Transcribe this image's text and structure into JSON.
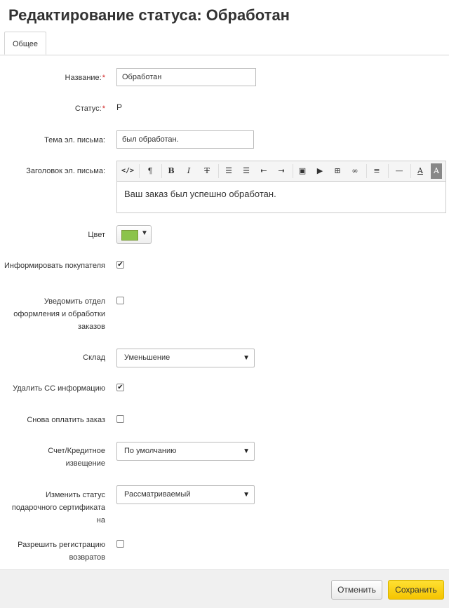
{
  "page": {
    "title": "Редактирование статуса: Обработан"
  },
  "tabs": [
    {
      "label": "Общее"
    }
  ],
  "fields": {
    "name": {
      "label": "Название:",
      "required": "*",
      "value": "Обработан"
    },
    "status": {
      "label": "Статус:",
      "required": "*",
      "value": "P"
    },
    "email_subject": {
      "label": "Тема эл. письма:",
      "value": "был обработан."
    },
    "email_header": {
      "label": "Заголовок эл. письма:",
      "value": "Ваш заказ был успешно обработан.",
      "toolbar_icons": [
        "code-view-icon",
        "paragraph-icon",
        "bold-icon",
        "italic-icon",
        "strikethrough-icon",
        "unordered-list-icon",
        "ordered-list-icon",
        "outdent-icon",
        "indent-icon",
        "image-icon",
        "video-icon",
        "table-icon",
        "link-icon",
        "align-icon",
        "horizontal-rule-icon",
        "font-color-icon",
        "background-color-icon"
      ]
    },
    "color": {
      "label": "Цвет",
      "value": "#8bc34a"
    },
    "notify_customer": {
      "label": "Информировать покупателя",
      "checked": true
    },
    "notify_department": {
      "label": "Уведомить отдел оформления и обработки заказов",
      "checked": false
    },
    "warehouse": {
      "label": "Склад",
      "value": "Уменьшение"
    },
    "remove_cc": {
      "label": "Удалить CC информацию",
      "checked": true
    },
    "repay_order": {
      "label": "Снова оплатить заказ",
      "checked": false
    },
    "invoice": {
      "label": "Счет/Кредитное извещение",
      "value": "По умолчанию"
    },
    "gift_cert_status": {
      "label": "Изменить статус подарочного сертификата на",
      "value": "Рассматриваемый"
    },
    "allow_returns": {
      "label": "Разрешить регистрацию возвратов",
      "checked": false
    }
  },
  "footer": {
    "cancel_label": "Отменить",
    "save_label": "Сохранить"
  },
  "colors": {
    "save_button": "#f5c400",
    "required_mark": "#d02020"
  }
}
